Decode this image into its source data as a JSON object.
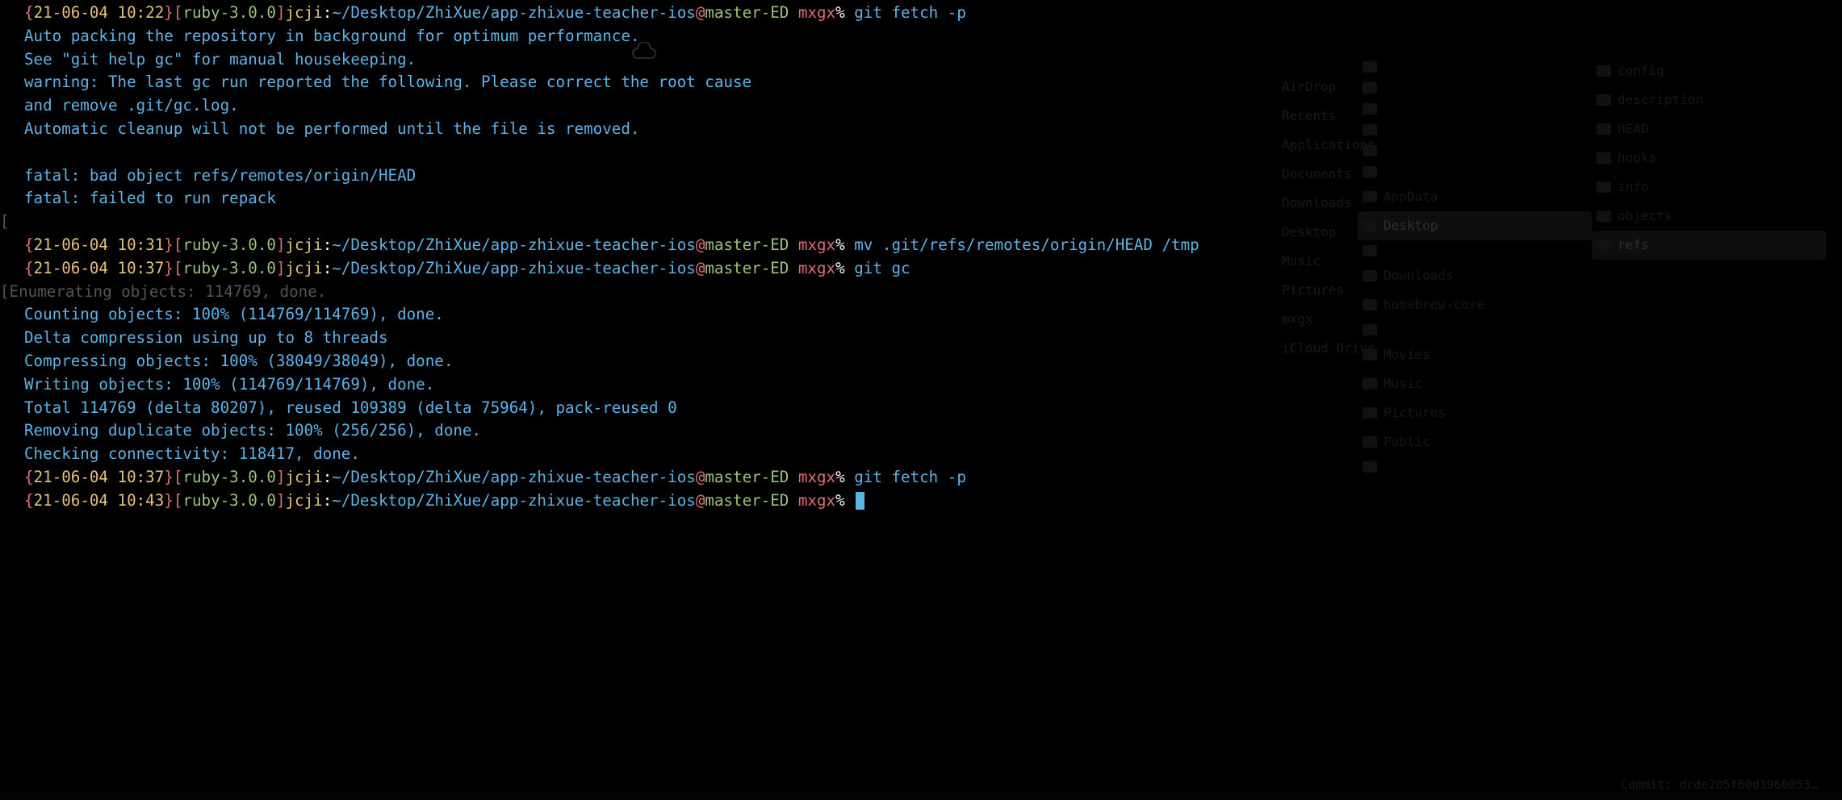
{
  "terminal": {
    "prompts": [
      {
        "ts": "21-06-04 10:22",
        "ruby": "ruby-3.0.0",
        "user": "jcji",
        "path": "~/Desktop/ZhiXue/app-zhixue-teacher-ios",
        "branch": "master-ED",
        "venv": "mxgx",
        "cmd": "git fetch -p"
      },
      {
        "ts": "21-06-04 10:31",
        "ruby": "ruby-3.0.0",
        "user": "jcji",
        "path": "~/Desktop/ZhiXue/app-zhixue-teacher-ios",
        "branch": "master-ED",
        "venv": "mxgx",
        "cmd": "mv .git/refs/remotes/origin/HEAD /tmp"
      },
      {
        "ts": "21-06-04 10:37",
        "ruby": "ruby-3.0.0",
        "user": "jcji",
        "path": "~/Desktop/ZhiXue/app-zhixue-teacher-ios",
        "branch": "master-ED",
        "venv": "mxgx",
        "cmd": "git gc"
      },
      {
        "ts": "21-06-04 10:37",
        "ruby": "ruby-3.0.0",
        "user": "jcji",
        "path": "~/Desktop/ZhiXue/app-zhixue-teacher-ios",
        "branch": "master-ED",
        "venv": "mxgx",
        "cmd": "git fetch -p"
      },
      {
        "ts": "21-06-04 10:43",
        "ruby": "ruby-3.0.0",
        "user": "jcji",
        "path": "~/Desktop/ZhiXue/app-zhixue-teacher-ios",
        "branch": "master-ED",
        "venv": "mxgx",
        "cmd": ""
      }
    ],
    "output_block_1": [
      "Auto packing the repository in background for optimum performance.",
      "See \"git help gc\" for manual housekeeping.",
      "warning: The last gc run reported the following. Please correct the root cause",
      "and remove .git/gc.log.",
      "Automatic cleanup will not be performed until the file is removed.",
      "",
      "fatal: bad object refs/remotes/origin/HEAD",
      "fatal: failed to run repack"
    ],
    "stray_bracket": "[",
    "output_block_2_first": "[Enumerating objects: 114769, done.",
    "output_block_2": [
      "Counting objects: 100% (114769/114769), done.",
      "Delta compression using up to 8 threads",
      "Compressing objects: 100% (38049/38049), done.",
      "Writing objects: 100% (114769/114769), done.",
      "Total 114769 (delta 80207), reused 109389 (delta 75964), pack-reused 0",
      "Removing duplicate objects: 100% (256/256), done.",
      "Checking connectivity: 118417, done."
    ]
  },
  "finder": {
    "sidebar_items": [
      "AirDrop",
      "Recents",
      "Applications",
      "Documents",
      "Downloads",
      "Desktop",
      "Music",
      "Pictures",
      "mxgx",
      "iCloud Drive"
    ],
    "col1_items": [
      "",
      "",
      "",
      "",
      "",
      "",
      "AppData",
      "Desktop",
      "",
      "Downloads",
      "homebrew-core",
      "",
      "Movies",
      "Music",
      "Pictures",
      "Public",
      ""
    ],
    "col1_sel": "Desktop",
    "col2_items": [
      "config",
      "description",
      "HEAD",
      "hooks",
      "info",
      "objects",
      "refs"
    ],
    "col2_sel": "refs",
    "commit_label": "Commit:",
    "commit_hash": "dcde205f60d1960053…"
  }
}
